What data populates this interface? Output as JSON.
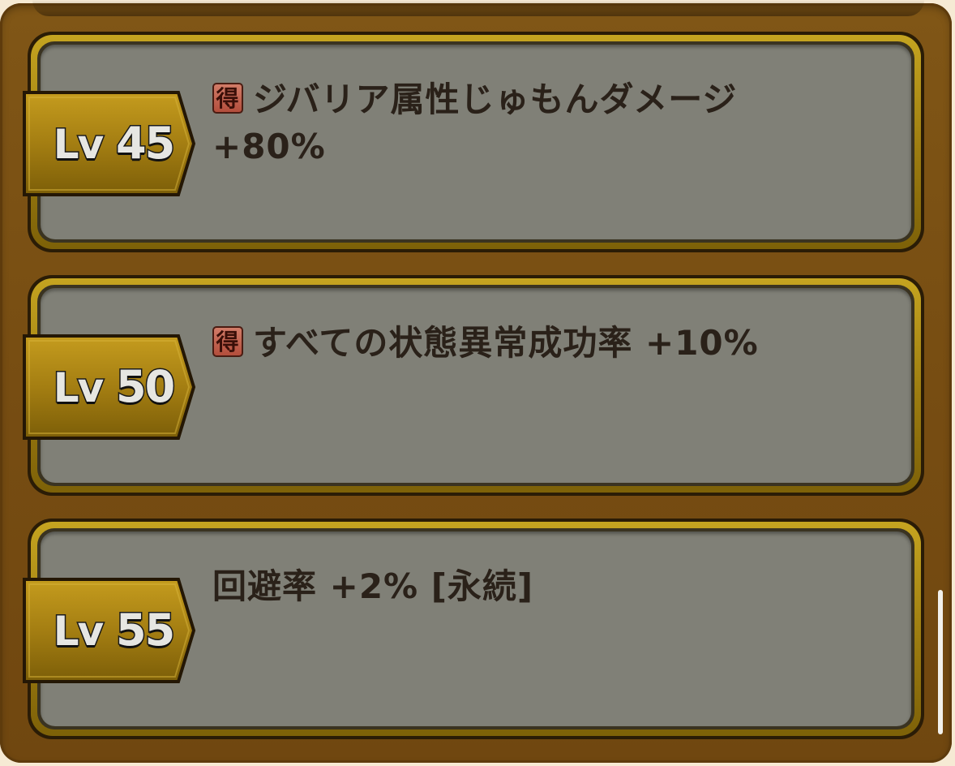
{
  "entries": [
    {
      "level_prefix": "Lv",
      "level": "45",
      "badge": "得",
      "text": "ジバリア属性じゅもんダメージ",
      "text2": "+80%"
    },
    {
      "level_prefix": "Lv",
      "level": "50",
      "badge": "得",
      "text": "すべての状態異常成功率 +10%"
    },
    {
      "level_prefix": "Lv",
      "level": "55",
      "text": "回避率 +2% [永続]"
    }
  ],
  "colors": {
    "frame_brown": "#774d12",
    "card_gold": "#b1921a",
    "card_fill": "#808077",
    "tag_gold": "#a47e12",
    "badge_red": "#b34e3c",
    "text_dark": "#2a2119"
  }
}
